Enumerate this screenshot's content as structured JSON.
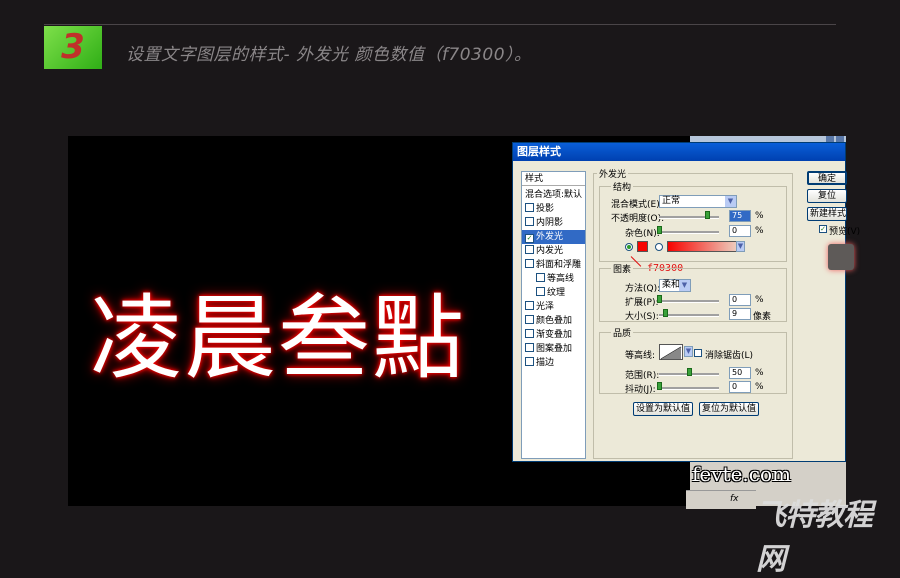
{
  "step": {
    "number": "3",
    "text": "设置文字图层的样式- 外发光 颜色数值（f70300）。"
  },
  "canvas": {
    "glow_text": "凌晨叁點",
    "glow_color": "#f70300"
  },
  "dialog": {
    "title": "图层样式",
    "style_list": {
      "header": "样式",
      "items": [
        {
          "label": "混合选项:默认",
          "type": "head"
        },
        {
          "label": "投影",
          "type": "check"
        },
        {
          "label": "内阴影",
          "type": "check"
        },
        {
          "label": "外发光",
          "type": "check",
          "selected": true,
          "checked": true
        },
        {
          "label": "内发光",
          "type": "check"
        },
        {
          "label": "斜面和浮雕",
          "type": "check"
        },
        {
          "label": "等高线",
          "type": "sub"
        },
        {
          "label": "纹理",
          "type": "sub"
        },
        {
          "label": "光泽",
          "type": "check"
        },
        {
          "label": "颜色叠加",
          "type": "check"
        },
        {
          "label": "渐变叠加",
          "type": "check"
        },
        {
          "label": "图案叠加",
          "type": "check"
        },
        {
          "label": "描边",
          "type": "check"
        }
      ]
    },
    "panel_title": "外发光",
    "structure": {
      "title": "结构",
      "blend_mode_label": "混合模式(E):",
      "blend_mode_value": "正常",
      "opacity_label": "不透明度(O):",
      "opacity_value": "75",
      "noise_label": "杂色(N):",
      "noise_value": "0",
      "percent": "%"
    },
    "elements": {
      "title": "图素",
      "method_label": "方法(Q):",
      "method_value": "柔和",
      "spread_label": "扩展(P):",
      "spread_value": "0",
      "size_label": "大小(S):",
      "size_value": "9",
      "size_unit": "像素",
      "percent": "%"
    },
    "quality": {
      "title": "品质",
      "contour_label": "等高线:",
      "antialias_label": "消除锯齿(L)",
      "range_label": "范围(R):",
      "range_value": "50",
      "jitter_label": "抖动(J):",
      "jitter_value": "0",
      "percent": "%"
    },
    "buttons": {
      "set_default": "设置为默认值",
      "reset_default": "复位为默认值",
      "ok": "确定",
      "reset": "复位",
      "new_style": "新建样式(W)...",
      "preview": "预览(V)"
    },
    "annotation": "f70300",
    "colors": {
      "glow": "#f70300",
      "title_bar": "#0a5fd8",
      "dialog_bg": "#ece9d8"
    }
  },
  "watermark": {
    "site": "fevte.com",
    "brand": "飞特教程网",
    "fx": "fx"
  }
}
